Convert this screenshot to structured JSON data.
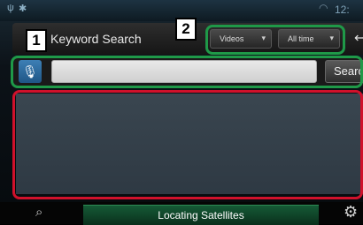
{
  "status_bar": {
    "usb_icon": "usb-icon",
    "android_icon": "android-icon",
    "wifi_icon": "wifi-icon",
    "clock": "12:"
  },
  "header": {
    "title": "Keyword Search",
    "type_dropdown": {
      "selected": "Videos"
    },
    "time_dropdown": {
      "selected": "All time"
    },
    "back_icon": "back-icon"
  },
  "search": {
    "mic_icon": "microphone-icon",
    "input_value": "",
    "button_label": "Search"
  },
  "results": {
    "items": []
  },
  "callouts": {
    "badge_1": "1",
    "badge_2": "2"
  },
  "bottom_bar": {
    "nav_icon": "navigation-icon",
    "status_text": "Locating Satellites",
    "settings_icon": "gear-icon"
  },
  "colors": {
    "callout_green": "#1f9948",
    "callout_red": "#d0112b",
    "mic_blue": "#2f6ea3",
    "status_green": "#155a36"
  }
}
